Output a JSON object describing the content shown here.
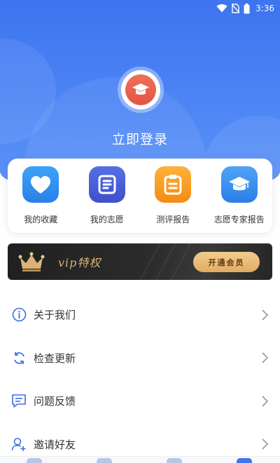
{
  "status_bar": {
    "time": "3:36"
  },
  "header": {
    "login_label": "立即登录"
  },
  "quick_actions": [
    {
      "label": "我的收藏",
      "icon": "heart-icon"
    },
    {
      "label": "我的志愿",
      "icon": "document-icon"
    },
    {
      "label": "测评报告",
      "icon": "clipboard-icon"
    },
    {
      "label": "志愿专家报告",
      "icon": "graduation-cap-icon"
    }
  ],
  "vip": {
    "title": "vip特权",
    "button_label": "开通会员"
  },
  "menu": [
    {
      "label": "关于我们",
      "icon": "info-icon"
    },
    {
      "label": "检查更新",
      "icon": "refresh-icon"
    },
    {
      "label": "问题反馈",
      "icon": "feedback-icon"
    },
    {
      "label": "邀请好友",
      "icon": "user-add-icon"
    }
  ],
  "colors": {
    "header_blue": "#3d74f0",
    "avatar_red": "#e45445",
    "vip_gold": "#d9b476",
    "menu_icon_blue": "#3a6fe0"
  }
}
